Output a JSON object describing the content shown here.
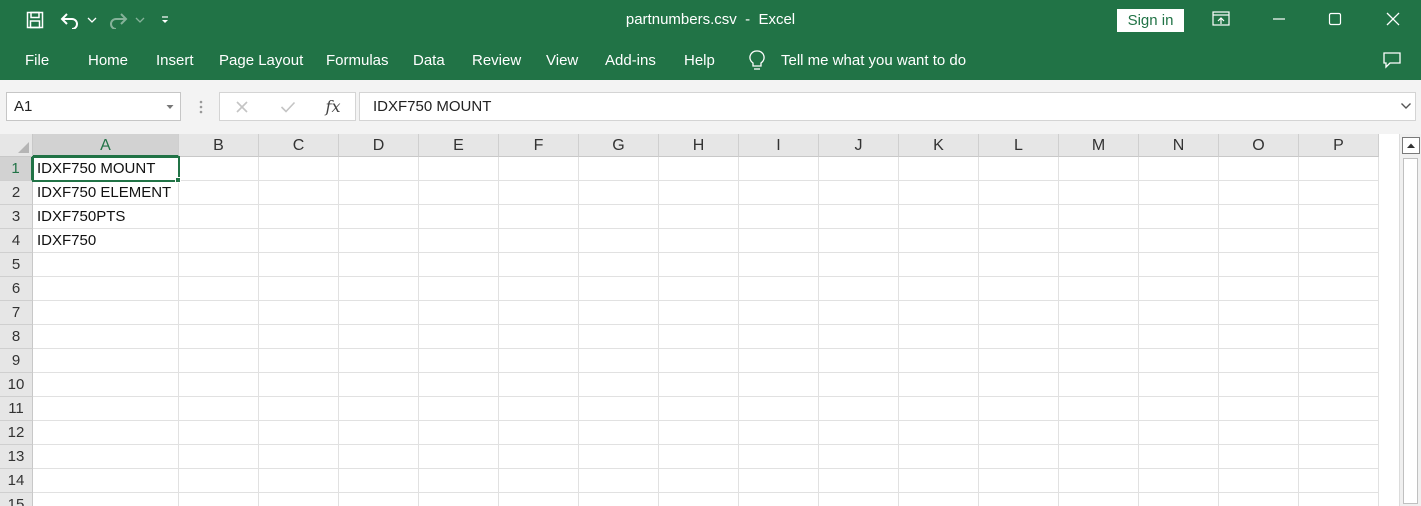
{
  "window": {
    "file_name": "partnumbers.csv",
    "separator": "-",
    "app_name": "Excel",
    "sign_in_label": "Sign in"
  },
  "ribbon": {
    "tabs": [
      "File",
      "Home",
      "Insert",
      "Page Layout",
      "Formulas",
      "Data",
      "Review",
      "View",
      "Add-ins",
      "Help"
    ],
    "tell_me": "Tell me what you want to do"
  },
  "formula_bar": {
    "name_box": "A1",
    "fx_label": "fx",
    "formula_value": "IDXF750 MOUNT"
  },
  "sheet": {
    "columns": [
      "A",
      "B",
      "C",
      "D",
      "E",
      "F",
      "G",
      "H",
      "I",
      "J",
      "K",
      "L",
      "M",
      "N",
      "O",
      "P"
    ],
    "rows": [
      "1",
      "2",
      "3",
      "4",
      "5",
      "6",
      "7",
      "8",
      "9",
      "10",
      "11",
      "12",
      "13",
      "14",
      "15"
    ],
    "active_cell": {
      "col": "A",
      "row": "1"
    },
    "column_a_values": [
      "IDXF750 MOUNT",
      "IDXF750 ELEMENT",
      "IDXF750PTS",
      "IDXF750"
    ]
  },
  "colors": {
    "accent": "#217346",
    "header_bg": "#e6e6e6",
    "gridline": "#e1e1e1"
  },
  "icons": {
    "save": "save-icon",
    "undo": "undo-icon",
    "redo": "redo-icon",
    "customize": "customize-qat-icon",
    "ribbon_display": "ribbon-display-icon",
    "minimize": "minimize-icon",
    "maximize": "maximize-icon",
    "close": "close-icon",
    "tell_me": "lightbulb-icon",
    "comments": "comment-icon",
    "cancel": "cancel-x-icon",
    "enter": "checkmark-icon"
  }
}
